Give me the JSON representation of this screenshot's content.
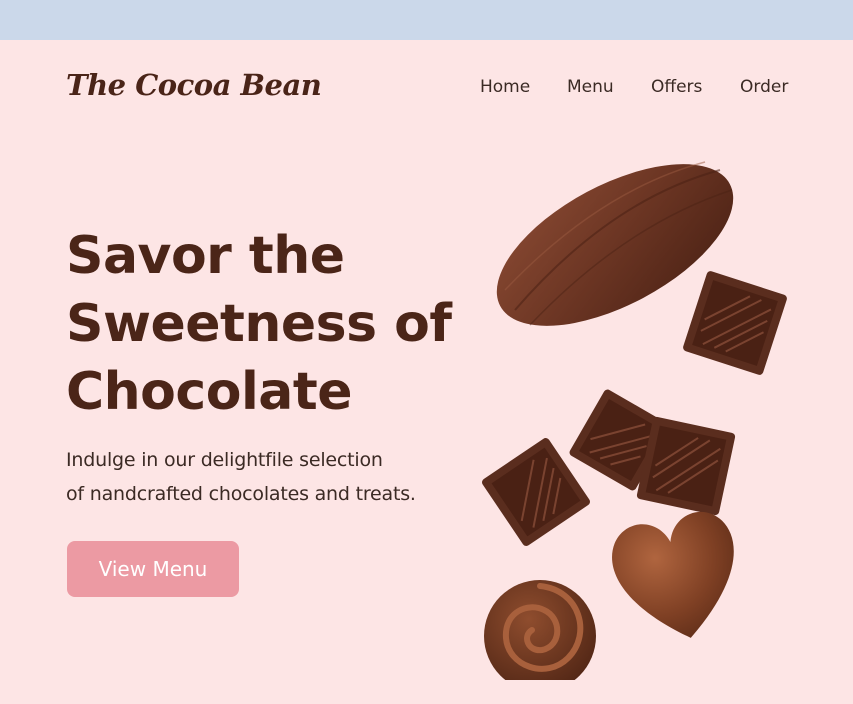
{
  "brand": {
    "name": "The Cocoa Bean"
  },
  "nav": {
    "items": [
      {
        "label": "Home"
      },
      {
        "label": "Menu"
      },
      {
        "label": "Offers"
      },
      {
        "label": "Order"
      }
    ]
  },
  "hero": {
    "headline_lines": [
      "Savor the",
      "Sweetness of",
      "Chocolate"
    ],
    "subtext_lines": [
      "Indulge in our delightfile selection",
      "of nandcrafted chocolates and treats."
    ],
    "cta_label": "View Menu"
  },
  "colors": {
    "background": "#fde5e5",
    "top_bar": "#cbd8ea",
    "heading": "#4b2518",
    "body_text": "#3b2a24",
    "button": "#ec9aa3",
    "button_text": "#ffffff",
    "chocolate": "#5a2d1e"
  },
  "illustration": {
    "icons": [
      "cocoa-pod",
      "chocolate-square",
      "chocolate-square",
      "chocolate-square",
      "chocolate-square",
      "chocolate-heart",
      "chocolate-swirl-truffle"
    ]
  }
}
